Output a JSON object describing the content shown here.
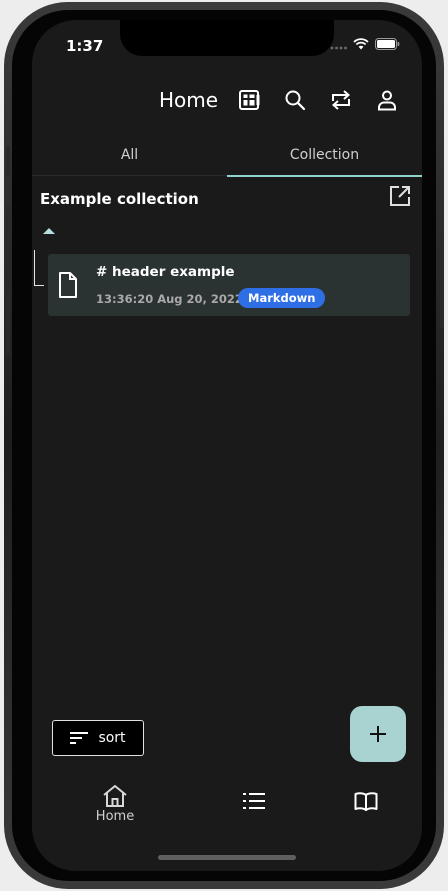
{
  "status_bar": {
    "time": "1:37"
  },
  "header": {
    "title": "Home"
  },
  "tabs": [
    {
      "label": "All",
      "active": false
    },
    {
      "label": "Collection",
      "active": true
    }
  ],
  "collection": {
    "title": "Example collection",
    "notes": [
      {
        "title": "# header example",
        "date": "13:36:20 Aug 20, 2022",
        "badge": "Markdown"
      }
    ]
  },
  "sort_label": "sort",
  "bottom_nav": [
    {
      "icon": "home-icon",
      "label": "Home",
      "active": true
    },
    {
      "icon": "list-icon",
      "label": ""
    },
    {
      "icon": "book-icon",
      "label": ""
    }
  ],
  "colors": {
    "background": "#1a1a1a",
    "accent": "#8fd3cc",
    "fab": "#a9d3d1",
    "badge": "#2f6fe6",
    "card": "#2b3232"
  }
}
